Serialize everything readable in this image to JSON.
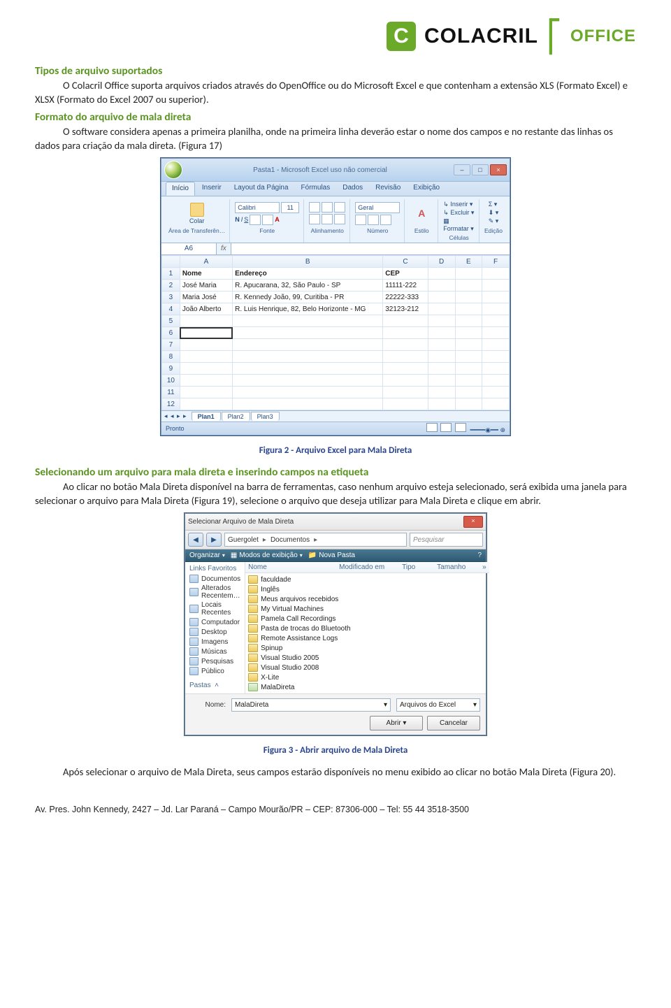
{
  "logo": {
    "mark_text": "C",
    "brand": "COLACRIL",
    "sub": "OFFICE"
  },
  "section1": {
    "heading": "Tipos de arquivo suportados",
    "p1": "O Colacril Office suporta arquivos criados através do OpenOffice ou do Microsoft Excel e que contenham a extensão XLS (Formato Excel) e XLSX (Formato do Excel 2007 ou superior)."
  },
  "section2": {
    "heading": "Formato do arquivo de mala direta",
    "p1": "O software considera apenas a primeira planilha, onde na primeira linha deverão estar o nome dos campos e no restante das linhas os dados para criação da mala direta. (Figura 17)"
  },
  "excel": {
    "title": "Pasta1 - Microsoft Excel uso não comercial",
    "tabs": [
      "Início",
      "Inserir",
      "Layout da Página",
      "Fórmulas",
      "Dados",
      "Revisão",
      "Exibição"
    ],
    "groups": {
      "transfer": "Área de Transferên…",
      "colar": "Colar",
      "fonte_label": "Fonte",
      "font_name": "Calibri",
      "font_size": "11",
      "alinhamento": "Alinhamento",
      "num_label": "Número",
      "num_fmt": "Geral",
      "estilo": "Estilo",
      "celulas": "Células",
      "inserir": "Inserir",
      "excluir": "Excluir",
      "formatar": "Formatar",
      "edicao": "Edição"
    },
    "name_box": "A6",
    "fx": "fx",
    "col_headers": [
      "",
      "A",
      "B",
      "C",
      "D",
      "E",
      "F"
    ],
    "rows": [
      {
        "n": "1",
        "a": "Nome",
        "b": "Endereço",
        "c": "CEP",
        "bold": true
      },
      {
        "n": "2",
        "a": "José Maria",
        "b": "R. Apucarana, 32, São Paulo - SP",
        "c": "11111-222"
      },
      {
        "n": "3",
        "a": "Maria José",
        "b": "R. Kennedy João, 99, Curitiba - PR",
        "c": "22222-333"
      },
      {
        "n": "4",
        "a": "João Alberto",
        "b": "R. Luis Henrique, 82, Belo Horizonte - MG",
        "c": "32123-212"
      },
      {
        "n": "5"
      },
      {
        "n": "6",
        "selected": true
      },
      {
        "n": "7"
      },
      {
        "n": "8"
      },
      {
        "n": "9"
      },
      {
        "n": "10"
      },
      {
        "n": "11"
      },
      {
        "n": "12"
      }
    ],
    "sheets": [
      "Plan1",
      "Plan2",
      "Plan3"
    ],
    "status": "Pronto"
  },
  "caption1": "Figura 2 - Arquivo Excel para Mala Direta",
  "section3": {
    "heading": "Selecionando um arquivo para mala direta e inserindo campos na etiqueta",
    "p1": "Ao clicar no botão Mala Direta disponível na barra de ferramentas, caso nenhum arquivo esteja selecionado, será exibida uma janela para selecionar o arquivo para Mala Direta (Figura 19), selecione o arquivo que deseja utilizar para Mala Direta e clique em abrir."
  },
  "dialog": {
    "title": "Selecionar Arquivo de Mala Direta",
    "path": [
      "Guergolet",
      "Documentos"
    ],
    "search_placeholder": "Pesquisar",
    "toolbar": {
      "organize": "Organizar",
      "views": "Modos de exibição",
      "newfolder": "Nova Pasta"
    },
    "side_head1": "Links Favoritos",
    "side_items1": [
      "Documentos",
      "Alterados Recentem…",
      "Locais Recentes",
      "Computador",
      "Desktop",
      "Imagens",
      "Músicas",
      "Pesquisas",
      "Público"
    ],
    "side_head2": "Pastas",
    "columns": [
      "Nome",
      "Modificado em",
      "Tipo",
      "Tamanho",
      "»"
    ],
    "items": [
      {
        "name": "faculdade",
        "type": "folder"
      },
      {
        "name": "Inglês",
        "type": "folder"
      },
      {
        "name": "Meus arquivos recebidos",
        "type": "folder"
      },
      {
        "name": "My Virtual Machines",
        "type": "folder"
      },
      {
        "name": "Pamela Call Recordings",
        "type": "folder"
      },
      {
        "name": "Pasta de trocas do Bluetooth",
        "type": "folder"
      },
      {
        "name": "Remote Assistance Logs",
        "type": "folder"
      },
      {
        "name": "Spinup",
        "type": "folder"
      },
      {
        "name": "Visual Studio 2005",
        "type": "folder"
      },
      {
        "name": "Visual Studio 2008",
        "type": "folder"
      },
      {
        "name": "X-Lite",
        "type": "folder"
      },
      {
        "name": "MalaDireta",
        "type": "file"
      }
    ],
    "name_label": "Nome:",
    "name_value": "MalaDireta",
    "type_value": "Arquivos do Excel",
    "open": "Abrir",
    "cancel": "Cancelar"
  },
  "caption2": "Figura 3 - Abrir arquivo de Mala Direta",
  "section4": {
    "p1": "Após selecionar o arquivo de Mala Direta, seus campos estarão disponíveis no menu exibido ao clicar no botão Mala Direta (Figura 20)."
  },
  "footer": "Av. Pres. John Kennedy, 2427 – Jd. Lar Paraná – Campo Mourão/PR – CEP: 87306-000 – Tel: 55 44 3518-3500"
}
